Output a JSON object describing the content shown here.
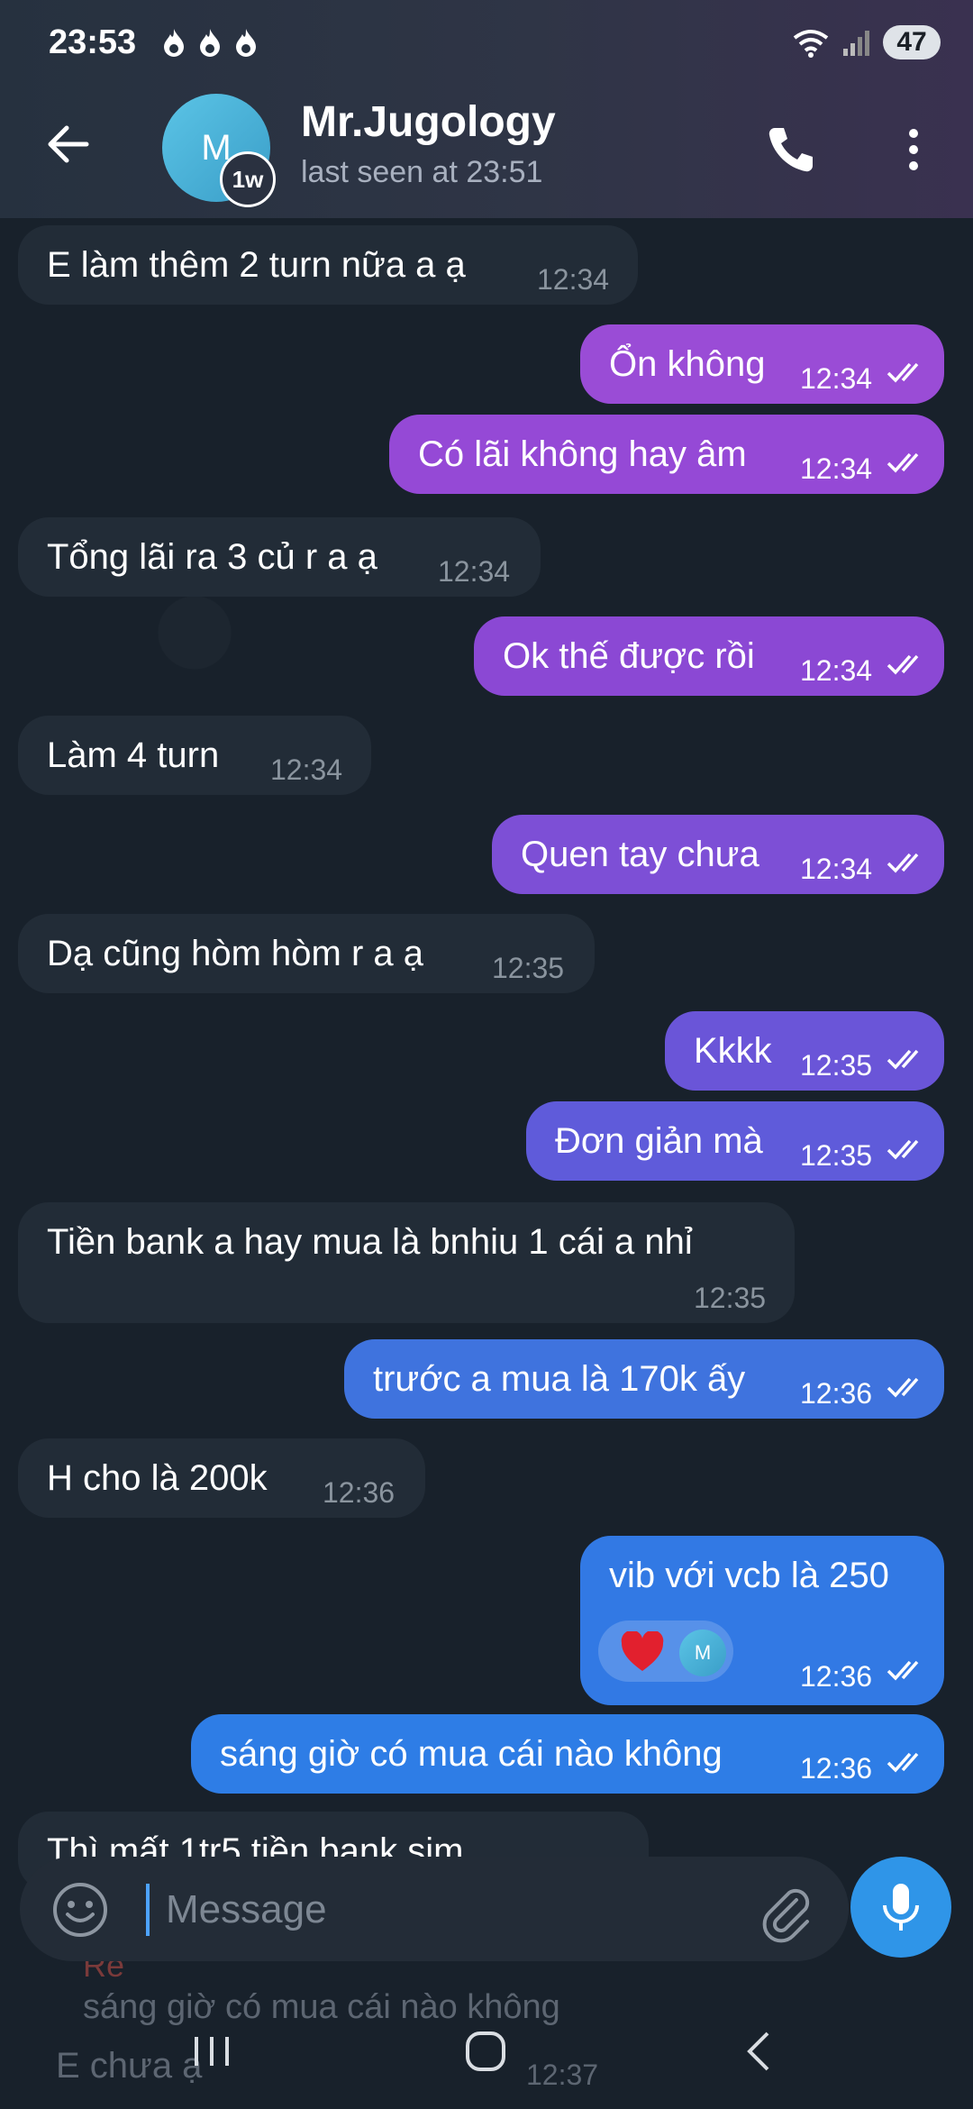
{
  "status": {
    "time": "23:53",
    "battery": "47"
  },
  "header": {
    "avatar_letter": "M",
    "badge": "1w",
    "name": "Mr.Jugology",
    "last_seen": "last seen at 23:51"
  },
  "messages": [
    {
      "text": "E làm thêm 2 turn nữa a ạ",
      "time": "12:34"
    },
    {
      "text": "Ổn không",
      "time": "12:34"
    },
    {
      "text": "Có lãi không hay âm",
      "time": "12:34"
    },
    {
      "text": "Tổng lãi ra 3 củ r a ạ",
      "time": "12:34"
    },
    {
      "text": "Ok thế được rồi",
      "time": "12:34"
    },
    {
      "text": "Làm 4 turn",
      "time": "12:34"
    },
    {
      "text": "Quen tay chưa",
      "time": "12:34"
    },
    {
      "text": "Dạ cũng hòm hòm r a ạ",
      "time": "12:35"
    },
    {
      "text": "Kkkk",
      "time": "12:35"
    },
    {
      "text": "Đơn giản mà",
      "time": "12:35"
    },
    {
      "text": "Tiền bank a hay mua là bnhiu 1 cái a nhỉ",
      "time": "12:35"
    },
    {
      "text": "trước a mua là 170k ấy",
      "time": "12:36"
    },
    {
      "text": "H cho là 200k",
      "time": "12:36"
    },
    {
      "text": "vib với vcb là 250",
      "time": "12:36",
      "reaction_avatar": "M"
    },
    {
      "text": "sáng giờ có mua cái nào không",
      "time": "12:36"
    }
  ],
  "ghost": {
    "partial_message": "Thì mất 1tr5 tiền bank sim",
    "reply_prefix": "Re",
    "reply_quote": "sáng giờ có mua cái nào không",
    "last_message": "E chưa ạ",
    "last_time": "12:37"
  },
  "input": {
    "placeholder": "Message"
  },
  "colors": {
    "incoming": "#222c37",
    "accent_blue": "#2f95e8"
  }
}
